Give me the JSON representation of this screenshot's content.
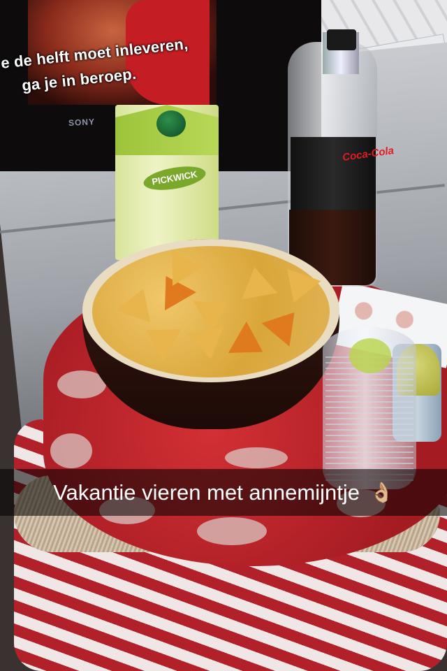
{
  "tv": {
    "subtitle_line1": "e de helft moet inleveren,",
    "subtitle_line2": "ga je in beroep.",
    "brand": "SONY"
  },
  "juice_carton": {
    "brand": "PICKWICK"
  },
  "bottle": {
    "brand": "Coca-Cola"
  },
  "caption": {
    "text": "Vakantie vieren met annemijntje",
    "emoji": "👌🏼"
  },
  "colors": {
    "ottoman_red": "#b8222a",
    "juice_green": "#9cc43a",
    "caption_bar": "#000000"
  }
}
